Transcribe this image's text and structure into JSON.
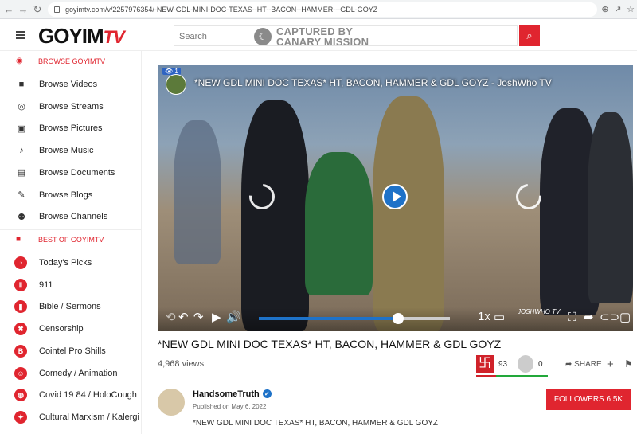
{
  "browser": {
    "url": "goyimtv.com/v/2257976354/-NEW-GDL-MINI-DOC-TEXAS--HT--BACON--HAMMER---GDL-GOYZ"
  },
  "header": {
    "logo_main": "GOYIM",
    "logo_tv": "TV",
    "search_placeholder": "Search",
    "canary_line1": "CAPTURED BY",
    "canary_line2": "CANARY MISSION"
  },
  "sidebar": {
    "browse_title": "BROWSE GOYIMTV",
    "browse_items": [
      {
        "label": "Browse Videos",
        "icon": "video-camera-icon"
      },
      {
        "label": "Browse Streams",
        "icon": "broadcast-icon"
      },
      {
        "label": "Browse Pictures",
        "icon": "picture-icon"
      },
      {
        "label": "Browse Music",
        "icon": "music-note-icon"
      },
      {
        "label": "Browse Documents",
        "icon": "document-icon"
      },
      {
        "label": "Browse Blogs",
        "icon": "pencil-icon"
      },
      {
        "label": "Browse Channels",
        "icon": "people-icon"
      }
    ],
    "best_title": "BEST OF GOYIMTV",
    "best_items": [
      {
        "label": "Today's Picks"
      },
      {
        "label": "911"
      },
      {
        "label": "Bible / Sermons"
      },
      {
        "label": "Censorship"
      },
      {
        "label": "Cointel Pro Shills"
      },
      {
        "label": "Comedy / Animation"
      },
      {
        "label": "Covid 19 84 / HoloCough"
      },
      {
        "label": "Cultural Marxism / Kalergi"
      }
    ]
  },
  "video": {
    "overlay_title": "*NEW GDL MINI DOC TEXAS* HT, BACON, HAMMER & GDL GOYZ - JoshWho TV",
    "overlay_views": "1",
    "speed": "1x",
    "watermark": "JOSHWHO TV",
    "progress": 0.73
  },
  "info": {
    "title": "*NEW GDL MINI DOC TEXAS* HT, BACON, HAMMER & GDL GOYZ",
    "views": "4,968 views",
    "like_count": "93",
    "dislike_count": "0",
    "share_label": "SHARE"
  },
  "channel": {
    "name": "HandsomeTruth",
    "published": "Published on May 6, 2022",
    "description": "*NEW GDL MINI DOC TEXAS* HT, BACON, HAMMER & GDL GOYZ",
    "follow_label": "FOLLOWERS 6.5K"
  },
  "colors": {
    "accent": "#e0252f",
    "player_blue": "#1e72c8"
  }
}
